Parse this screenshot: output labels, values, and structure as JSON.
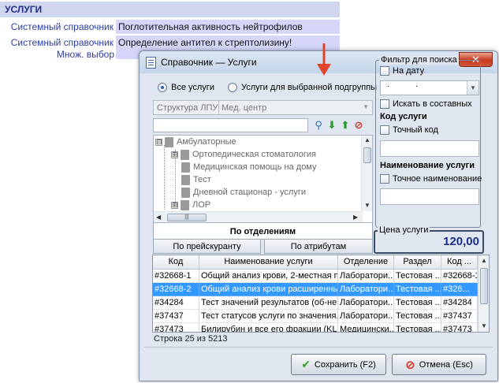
{
  "background": {
    "header": "УСЛУГИ",
    "rows": [
      {
        "label": "Системный справочник",
        "value": "Поглотительная активность нейтрофилов"
      },
      {
        "label": "Системный справочник",
        "value": "Определение антител к стрептолизину!"
      }
    ],
    "sub_label": "Множ. выбор"
  },
  "dialog": {
    "title": "Справочник — Услуги",
    "close_label": "✕",
    "radio_all": "Все услуги",
    "radio_subgroup": "Услуги для выбранной подгруппы",
    "struct_label": "Структура ЛПУ",
    "struct_value": "Мед. центр",
    "tree": [
      {
        "label": "Амбулаторные",
        "expander": "⊟"
      },
      {
        "label": "Ортопедическая стоматология",
        "expander": "⊞"
      },
      {
        "label": "Медицинская помощь на дому",
        "expander": ""
      },
      {
        "label": "Тест",
        "expander": ""
      },
      {
        "label": "Дневной стационар - услуги",
        "expander": ""
      },
      {
        "label": "ЛОР",
        "expander": "⊞"
      }
    ],
    "tabs": {
      "active": "По отделениям",
      "second": "По прейскуранту",
      "third": "По атрибутам"
    },
    "filter": {
      "legend": "Фильтр для поиска",
      "by_date": "На дату",
      "date_value": ". .",
      "search_in_composite": "Искать в составных",
      "service_code_title": "Код услуги",
      "exact_code": "Точный код",
      "service_name_title": "Наименование услуги",
      "exact_name": "Точное наименование"
    },
    "price": {
      "legend": "Цена услуги",
      "value": "120,00"
    },
    "grid": {
      "columns": [
        "Код",
        "Наименование услуги",
        "Отделение",
        "Раздел",
        "Код ..."
      ],
      "rows": [
        [
          "#32668-1",
          "Общий анализ крови, 2-местная п...",
          "Лаборатори...",
          "Тестовая ...",
          "#32668-1"
        ],
        [
          "#32668-2",
          "Общий анализ крови расширенный",
          "Лаборатори...",
          "Тестовая ...",
          "#326..."
        ],
        [
          "#34284",
          "Тест значений результатов (об-не...",
          "Лаборатори...",
          "Тестовая ...",
          "#34284"
        ],
        [
          "#37437",
          "Тест статусов услуги по значения...",
          "Лаборатори...",
          "Тестовая ...",
          "#37437"
        ],
        [
          "#37473",
          "Билирубин и все его фракции (KL)",
          "Медицински...",
          "Тестовая ...",
          "#37473"
        ]
      ],
      "selected_index": 1
    },
    "status": "Строка 25 из 5213",
    "save_label": "Сохранить (F2)",
    "cancel_label": "Отмена (Esc)"
  },
  "colors": {
    "accent": "#3399ff",
    "price": "#1a2d8c",
    "arrow": "#e0452a",
    "close": "#c6391f"
  },
  "icons": [
    "page-icon",
    "search-icon",
    "arrow-down-icon",
    "arrow-up-icon",
    "clear-icon",
    "checkmark-icon",
    "cancel-icon"
  ]
}
